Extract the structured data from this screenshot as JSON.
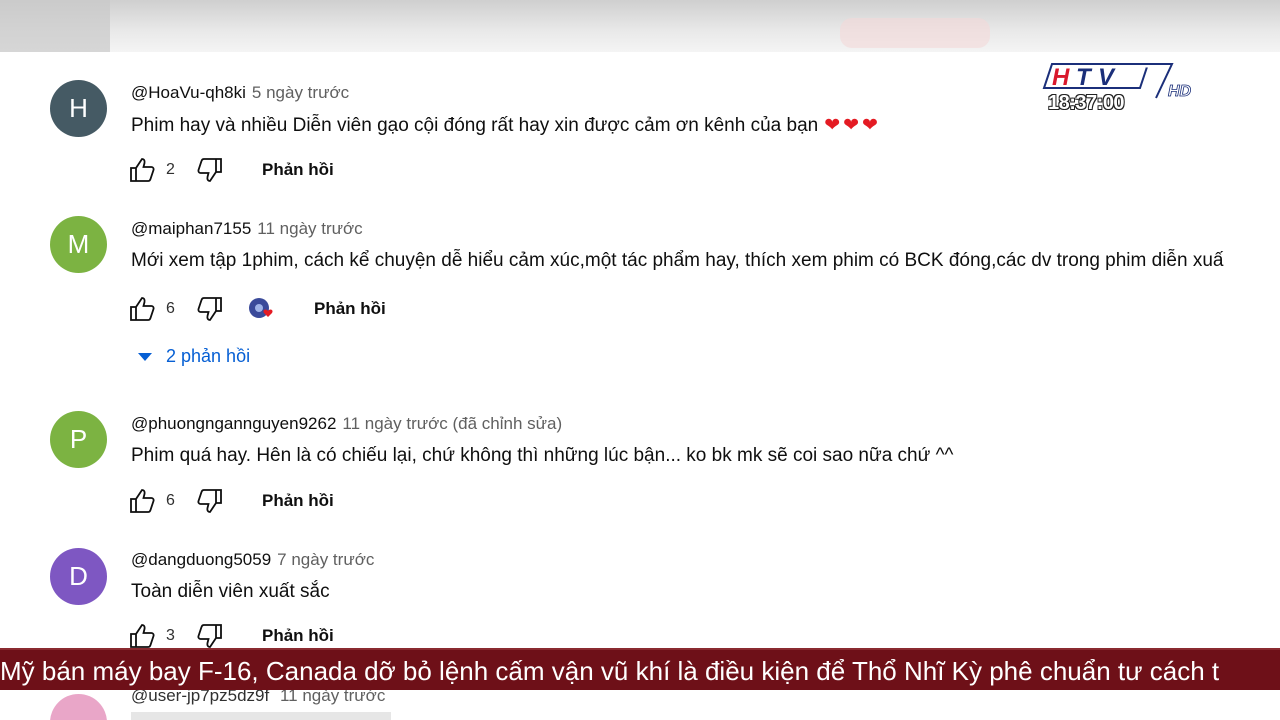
{
  "channel_logo": {
    "text": "HTV7",
    "suffix": "HD",
    "clock": "18:37:00"
  },
  "comments": [
    {
      "handle": "@HoaVu-qh8ki",
      "time": "5 ngày trước",
      "avatar_letter": "H",
      "avatar_color": "#455a64",
      "text": "Phim hay và nhiều Diễn viên gạo cội đóng rất hay xin được cảm ơn kênh của bạn",
      "hearts": "❤❤❤",
      "likes": "2",
      "reply_label": "Phản hồi"
    },
    {
      "handle": "@maiphan7155",
      "time": "11 ngày trước",
      "avatar_letter": "M",
      "avatar_color": "#7cb342",
      "text": "Mới xem tập 1phim, cách kể chuyện dễ hiểu cảm xúc,một tác phẩm hay, thích xem phim có BCK đóng,các dv trong phim diễn xuấ",
      "likes": "6",
      "reply_label": "Phản hồi",
      "replies_toggle": "2 phản hồi"
    },
    {
      "handle": "@phuongngannguyen9262",
      "time": "11 ngày trước (đã chỉnh sửa)",
      "avatar_letter": "P",
      "avatar_color": "#7cb342",
      "text": "Phim quá hay. Hên là có chiếu lại, chứ không thì những lúc bận... ko bk mk sẽ coi sao nữa chứ ^^",
      "likes": "6",
      "reply_label": "Phản hồi"
    },
    {
      "handle": "@dangduong5059",
      "time": "7 ngày trước",
      "avatar_letter": "D",
      "avatar_color": "#7e57c2",
      "text": "Toàn diễn viên xuất sắc",
      "likes": "3",
      "reply_label": "Phản hồi"
    }
  ],
  "partial_comment": {
    "handle": "@user-jp7pz5dz9f",
    "time": "11 ngày trước"
  },
  "ticker": "Mỹ bán máy bay F-16, Canada dỡ bỏ lệnh cấm vận vũ khí là điều kiện để Thổ Nhĩ Kỳ phê chuẩn tư cách t"
}
